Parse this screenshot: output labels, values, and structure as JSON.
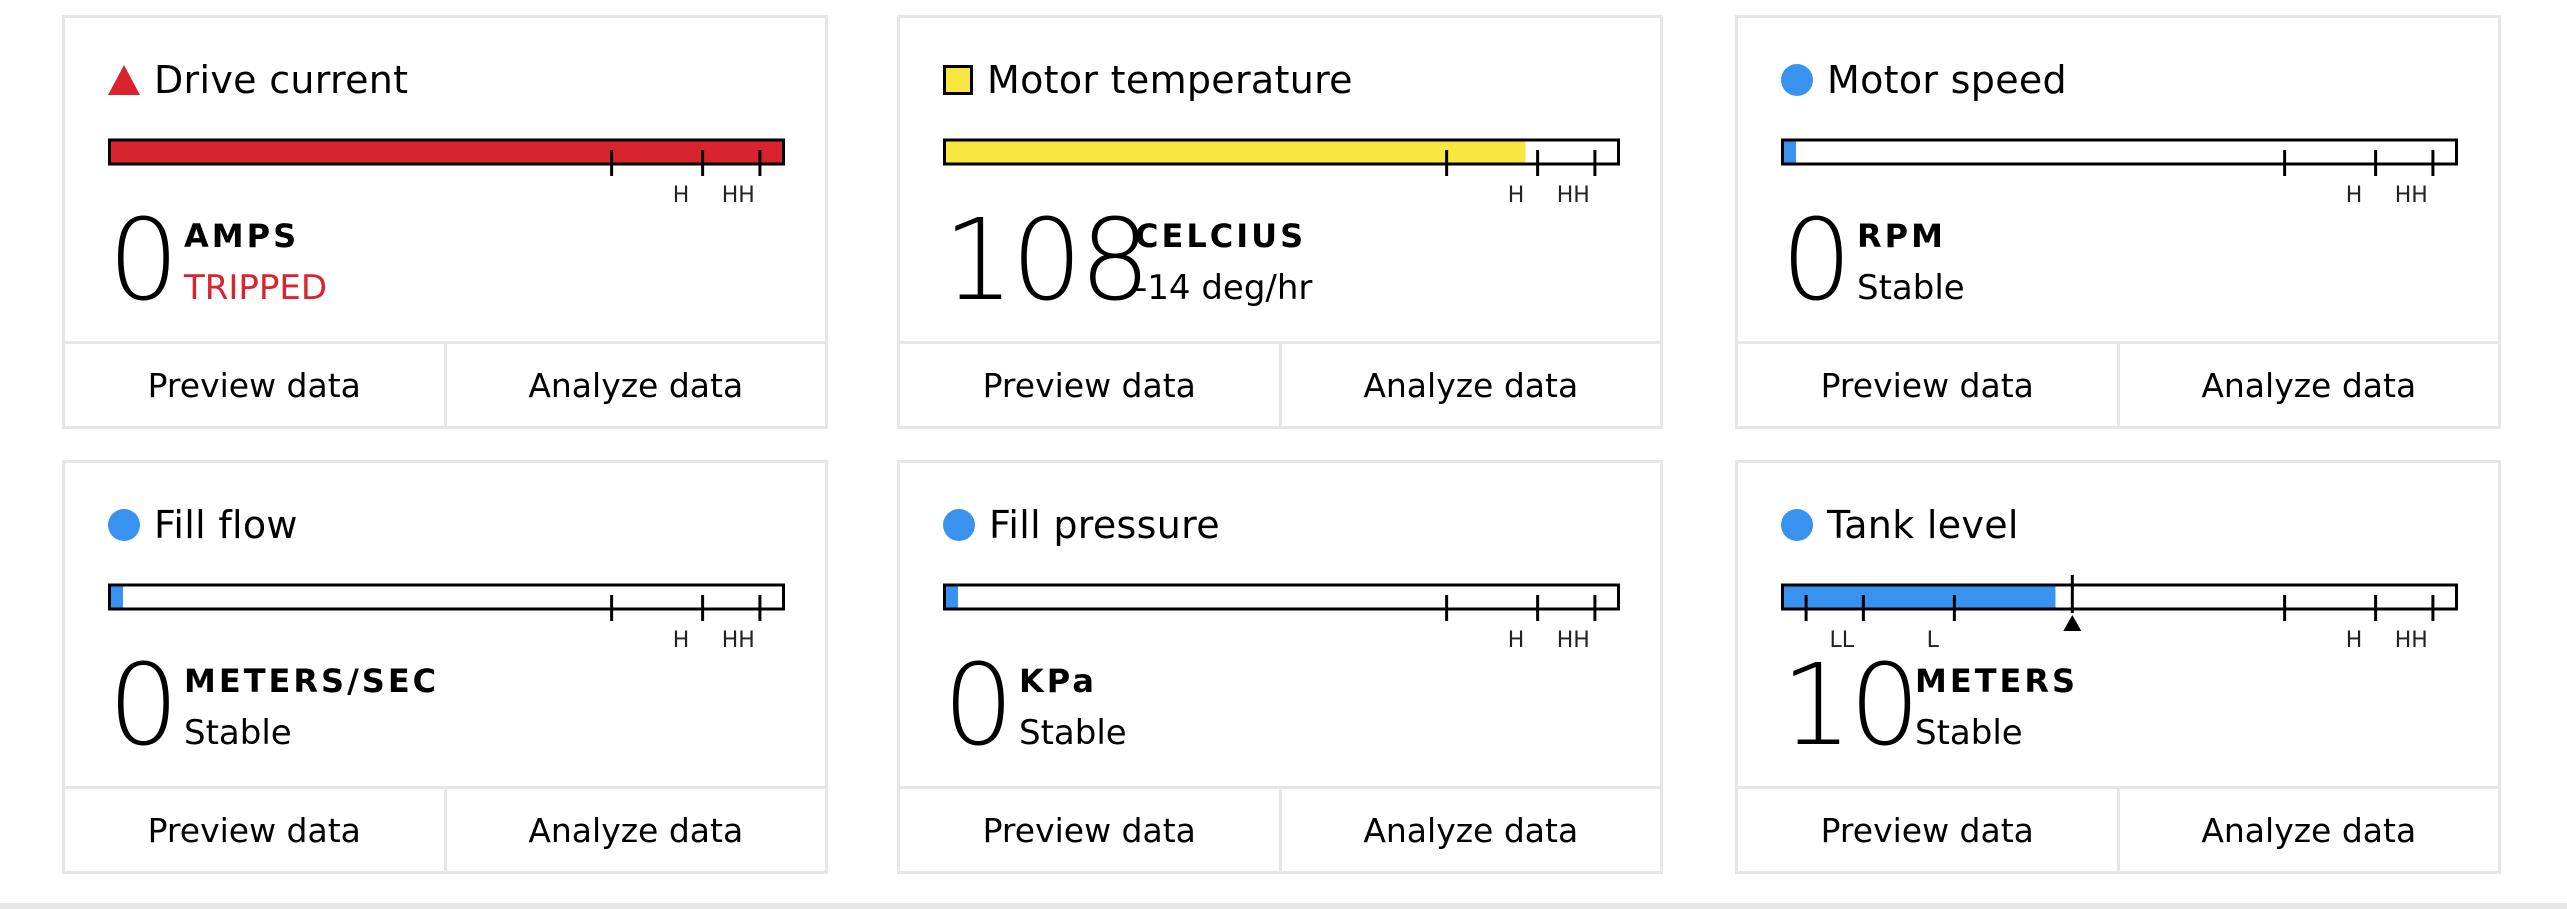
{
  "colors": {
    "alarm": "#d9232e",
    "warning": "#f7e73f",
    "normal": "#3a92f0",
    "outline": "#000000",
    "border": "#e6e6e6"
  },
  "cards": [
    {
      "title": "Drive current",
      "icon": "triangle-alarm-icon",
      "value": "0",
      "unit": "AMPS",
      "status": "TRIPPED",
      "status_color": "#d9232e",
      "fill_fraction": 1.0,
      "fill_color": "#d9232e",
      "ticks": [
        {
          "pos": 0.745,
          "label": ""
        },
        {
          "pos": 0.88,
          "label": "H"
        },
        {
          "pos": 0.965,
          "label": "HH"
        }
      ],
      "marker": null,
      "buttons": [
        "Preview data",
        "Analyze data"
      ]
    },
    {
      "title": "Motor temperature",
      "icon": "square-warning-icon",
      "value": "108",
      "unit": "CELCIUS",
      "status": "-14 deg/hr",
      "status_color": "#000000",
      "fill_fraction": 0.862,
      "fill_color": "#f7e73f",
      "ticks": [
        {
          "pos": 0.745,
          "label": ""
        },
        {
          "pos": 0.88,
          "label": "H"
        },
        {
          "pos": 0.965,
          "label": "HH"
        }
      ],
      "marker": null,
      "buttons": [
        "Preview data",
        "Analyze data"
      ]
    },
    {
      "title": "Motor speed",
      "icon": "circle-normal-icon",
      "value": "0",
      "unit": "RPM",
      "status": "Stable",
      "status_color": "#000000",
      "fill_fraction": 0.02,
      "fill_color": "#3a92f0",
      "ticks": [
        {
          "pos": 0.745,
          "label": ""
        },
        {
          "pos": 0.88,
          "label": "H"
        },
        {
          "pos": 0.965,
          "label": "HH"
        }
      ],
      "marker": null,
      "buttons": [
        "Preview data",
        "Analyze data"
      ]
    },
    {
      "title": "Fill flow",
      "icon": "circle-normal-icon",
      "value": "0",
      "unit": "METERS/SEC",
      "status": "Stable",
      "status_color": "#000000",
      "fill_fraction": 0.02,
      "fill_color": "#3a92f0",
      "ticks": [
        {
          "pos": 0.745,
          "label": ""
        },
        {
          "pos": 0.88,
          "label": "H"
        },
        {
          "pos": 0.965,
          "label": "HH"
        }
      ],
      "marker": null,
      "buttons": [
        "Preview data",
        "Analyze data"
      ]
    },
    {
      "title": "Fill pressure",
      "icon": "circle-normal-icon",
      "value": "0",
      "unit": "KPa",
      "status": "Stable",
      "status_color": "#000000",
      "fill_fraction": 0.02,
      "fill_color": "#3a92f0",
      "ticks": [
        {
          "pos": 0.745,
          "label": ""
        },
        {
          "pos": 0.88,
          "label": "H"
        },
        {
          "pos": 0.965,
          "label": "HH"
        }
      ],
      "marker": null,
      "buttons": [
        "Preview data",
        "Analyze data"
      ]
    },
    {
      "title": "Tank level",
      "icon": "circle-normal-icon",
      "value": "10",
      "unit": "METERS",
      "status": "Stable",
      "status_color": "#000000",
      "fill_fraction": 0.405,
      "fill_color": "#3a92f0",
      "ticks": [
        {
          "pos": 0.035,
          "label": ""
        },
        {
          "pos": 0.12,
          "label": "LL"
        },
        {
          "pos": 0.255,
          "label": "L"
        },
        {
          "pos": 0.745,
          "label": ""
        },
        {
          "pos": 0.88,
          "label": "H"
        },
        {
          "pos": 0.965,
          "label": "HH"
        }
      ],
      "marker": {
        "pos": 0.43
      },
      "buttons": [
        "Preview data",
        "Analyze data"
      ]
    }
  ]
}
